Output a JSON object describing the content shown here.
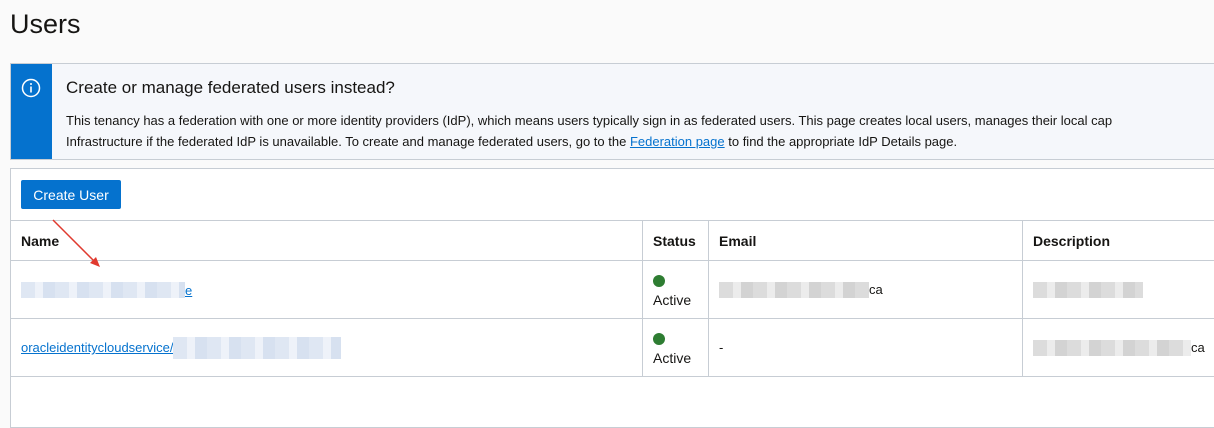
{
  "page": {
    "title": "Users"
  },
  "banner": {
    "title": "Create or manage federated users instead?",
    "line1": "This tenancy has a federation with one or more identity providers (IdP), which means users typically sign in as federated users. This page creates local users, manages their local cap",
    "line2_before": "Infrastructure if the federated IdP is unavailable. To create and manage federated users, go to the ",
    "link": "Federation page",
    "line2_after": " to find the appropriate IdP Details page.",
    "icon": "info-icon"
  },
  "toolbar": {
    "create_label": "Create User"
  },
  "table": {
    "columns": [
      "Name",
      "Status",
      "Email",
      "Description"
    ],
    "rows": [
      {
        "name": "e",
        "status": "Active",
        "email_suffix": "ca",
        "description": ""
      },
      {
        "name": "oracleidentitycloudservice/",
        "status": "Active",
        "email": "-",
        "description_suffix": "ca"
      }
    ]
  },
  "colors": {
    "accent": "#0572ce",
    "active": "#2e7d32",
    "annotation": "#e03a2f"
  }
}
